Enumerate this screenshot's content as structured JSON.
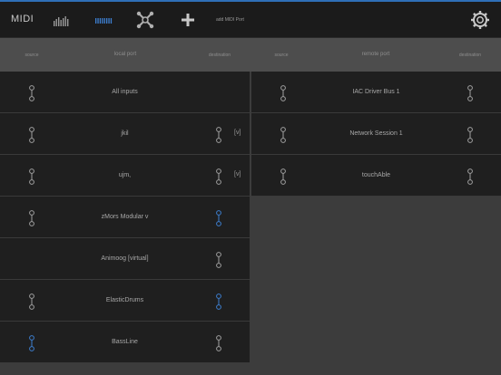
{
  "app": {
    "title": "MIDI"
  },
  "toolbar": {
    "add_midi_port_label": "add MIDI Port",
    "icons": [
      "level-meter-icon",
      "channel-bars-icon",
      "routing-icon",
      "add-icon",
      "settings-gear-icon"
    ],
    "active_color": "#3d7fd0"
  },
  "headers": {
    "left_source": "source",
    "left_local_port": "local port",
    "left_destination": "destination",
    "right_source": "source",
    "right_remote_port": "remote port",
    "right_destination": "destination"
  },
  "local_ports": [
    {
      "name": "All inputs",
      "source": "inactive",
      "destination": "none",
      "tag": ""
    },
    {
      "name": "jkil",
      "source": "inactive",
      "destination": "inactive",
      "tag": "[v]"
    },
    {
      "name": "ujm,",
      "source": "inactive",
      "destination": "inactive",
      "tag": "[v]"
    },
    {
      "name": "zMors Modular v",
      "source": "inactive",
      "destination": "active",
      "tag": ""
    },
    {
      "name": "Animoog [virtual]",
      "source": "none",
      "destination": "inactive",
      "tag": ""
    },
    {
      "name": "ElasticDrums",
      "source": "inactive",
      "destination": "active",
      "tag": ""
    },
    {
      "name": "BassLine",
      "source": "active",
      "destination": "inactive",
      "tag": ""
    }
  ],
  "remote_ports": [
    {
      "name": "IAC Driver Bus 1",
      "source": "inactive",
      "destination": "inactive"
    },
    {
      "name": "Network Session 1",
      "source": "inactive",
      "destination": "inactive"
    },
    {
      "name": "touchAble",
      "source": "inactive",
      "destination": "inactive"
    }
  ],
  "colors": {
    "inactive": "#a0a0a0",
    "active": "#3d7fd0"
  }
}
